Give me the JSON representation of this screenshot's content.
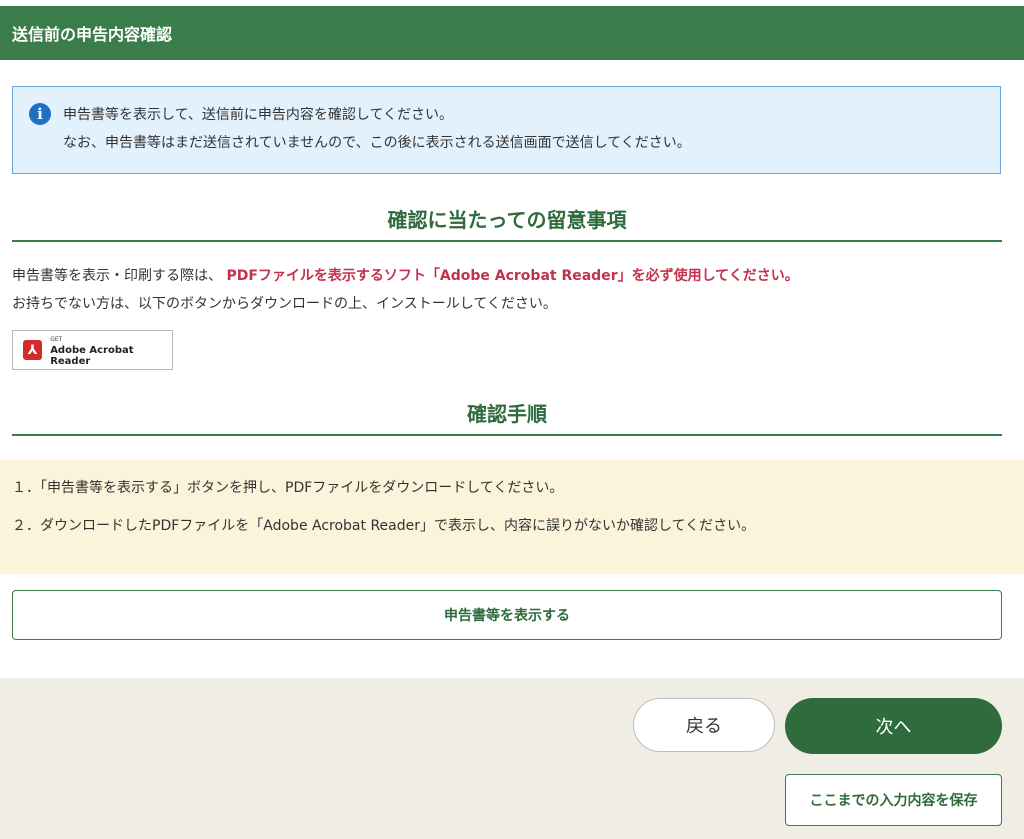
{
  "header": {
    "title": "送信前の申告内容確認"
  },
  "info": {
    "icon": "info-icon",
    "line1": "申告書等を表示して、送信前に申告内容を確認してください。",
    "line2": "なお、申告書等はまだ送信されていませんので、この後に表示される送信画面で送信してください。"
  },
  "notes": {
    "title": "確認に当たっての留意事項",
    "text_prefix": "申告書等を表示・印刷する際は、",
    "text_emphasis": "PDFファイルを表示するソフト「Adobe Acrobat Reader」を必ず使用してください。",
    "text_line2": "お持ちでない方は、以下のボタンからダウンロードの上、インストールしてください。",
    "acrobat_get": "GET",
    "acrobat_name": "Adobe Acrobat Reader"
  },
  "procedure": {
    "title": "確認手順",
    "steps": [
      "１．「申告書等を表示する」ボタンを押し、PDFファイルをダウンロードしてください。",
      "２．ダウンロードしたPDFファイルを「Adobe Acrobat Reader」で表示し、内容に誤りがないか確認してください。"
    ]
  },
  "buttons": {
    "show": "申告書等を表示する",
    "back": "戻る",
    "next": "次へ",
    "save": "ここまでの入力内容を保存"
  },
  "colors": {
    "header_green": "#3a7d4a",
    "emphasis_red": "#c4314b",
    "info_bg": "#e3f1fc",
    "steps_bg": "#fbf3da",
    "footer_bg": "#f0ede4"
  }
}
